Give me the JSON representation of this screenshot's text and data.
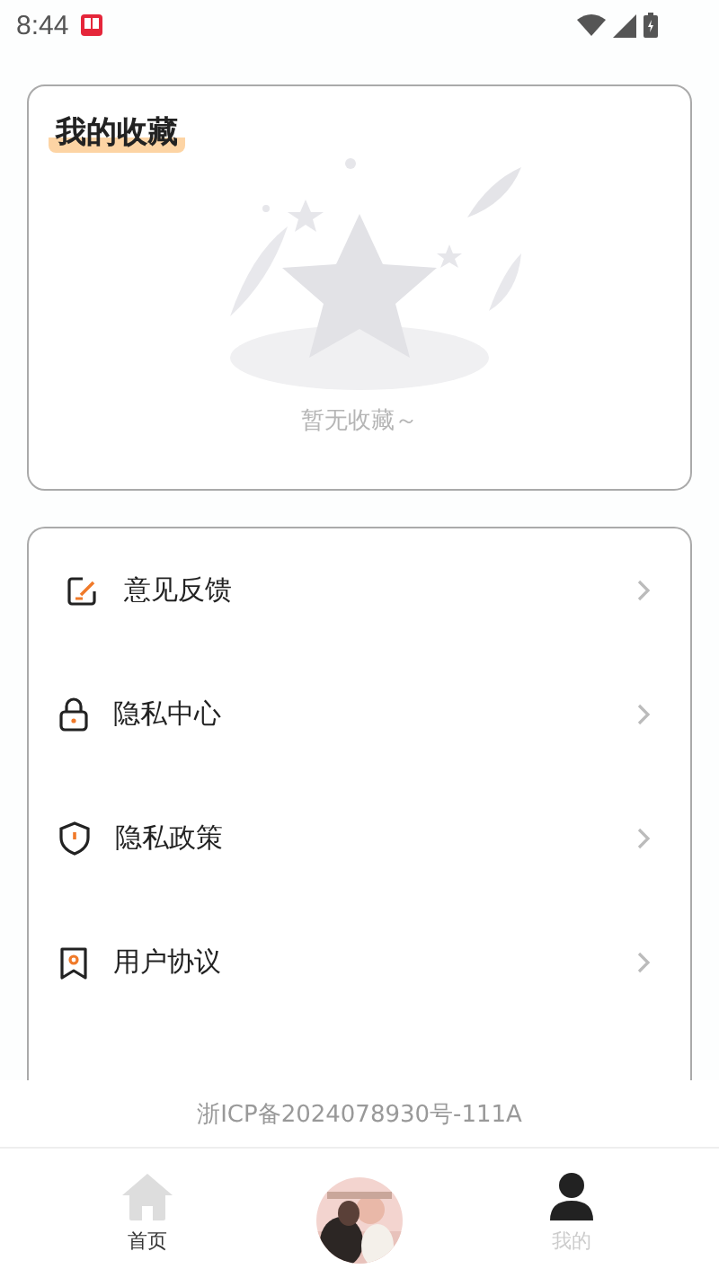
{
  "status_bar": {
    "time": "8:44"
  },
  "favorites": {
    "title": "我的收藏",
    "empty_text": "暂无收藏～"
  },
  "menu": [
    {
      "kind": "feedback",
      "label": "意见反馈"
    },
    {
      "kind": "lock",
      "label": "隐私中心"
    },
    {
      "kind": "shield",
      "label": "隐私政策"
    },
    {
      "kind": "agreement",
      "label": "用户协议"
    }
  ],
  "footer": {
    "icp": "浙ICP备2024078930号-111A"
  },
  "tabs": [
    {
      "kind": "home",
      "label": "首页",
      "selected": false
    },
    {
      "kind": "picture"
    },
    {
      "kind": "profile",
      "label": "我的",
      "selected": true
    }
  ]
}
